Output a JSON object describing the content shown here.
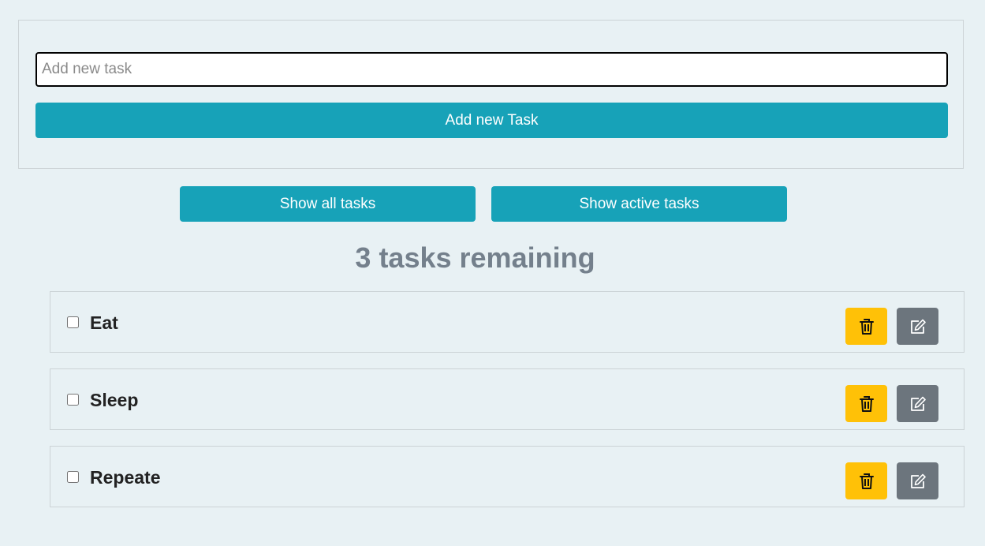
{
  "add_form": {
    "input_placeholder": "Add new task",
    "input_value": "",
    "add_button_label": "Add new Task"
  },
  "filters": {
    "show_all_label": "Show all tasks",
    "show_active_label": "Show active tasks"
  },
  "remaining_text": "3 tasks remaining",
  "tasks": [
    {
      "label": "Eat",
      "checked": false
    },
    {
      "label": "Sleep",
      "checked": false
    },
    {
      "label": "Repeate",
      "checked": false
    }
  ],
  "icons": {
    "delete": "trash-icon",
    "edit": "pencil-square-icon"
  },
  "colors": {
    "background": "#e8f1f4",
    "primary": "#17a2b8",
    "delete": "#ffc107",
    "edit": "#6c757d",
    "remaining_text": "#74808c"
  }
}
